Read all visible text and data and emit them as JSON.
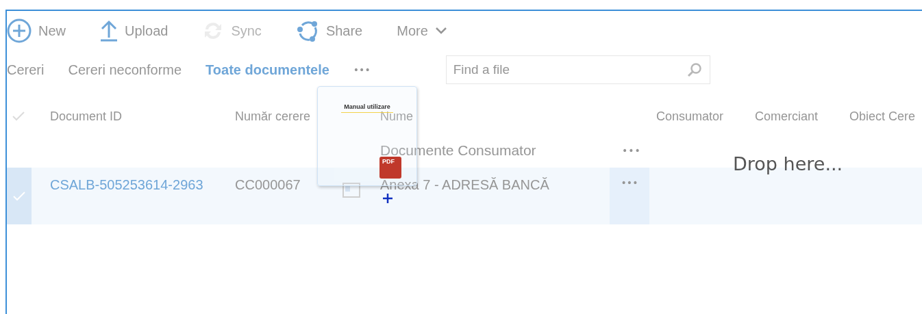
{
  "toolbar": [
    {
      "kind": "new",
      "label": "New",
      "disabled": false
    },
    {
      "kind": "upload",
      "label": "Upload",
      "disabled": false
    },
    {
      "kind": "sync",
      "label": "Sync",
      "disabled": true
    },
    {
      "kind": "share",
      "label": "Share",
      "disabled": false
    },
    {
      "kind": "more",
      "label": "More",
      "disabled": false
    }
  ],
  "views": [
    {
      "label": "Cereri",
      "selected": false
    },
    {
      "label": "Cereri neconforme",
      "selected": false
    },
    {
      "label": "Toate documentele",
      "selected": true
    }
  ],
  "views_more": "•••",
  "search": {
    "placeholder": "Find a file"
  },
  "table": {
    "columns": [
      "Document ID",
      "Număr cerere",
      "Nume",
      "Consumator",
      "Comerciant",
      "Obiect Cere"
    ],
    "group": {
      "label": "Documente Consumator",
      "more": "•••"
    },
    "rows": [
      {
        "selected": true,
        "document_id": "CSALB-505253614-2963",
        "numar_cerere": "CC000067",
        "nume": "Anexa 7 - ADRESĂ BANCĂ",
        "more": "•••"
      }
    ]
  },
  "drag_preview": {
    "page_title": "Manual utilizare",
    "badge": "PDF"
  },
  "drop_hint": "Drop here..."
}
